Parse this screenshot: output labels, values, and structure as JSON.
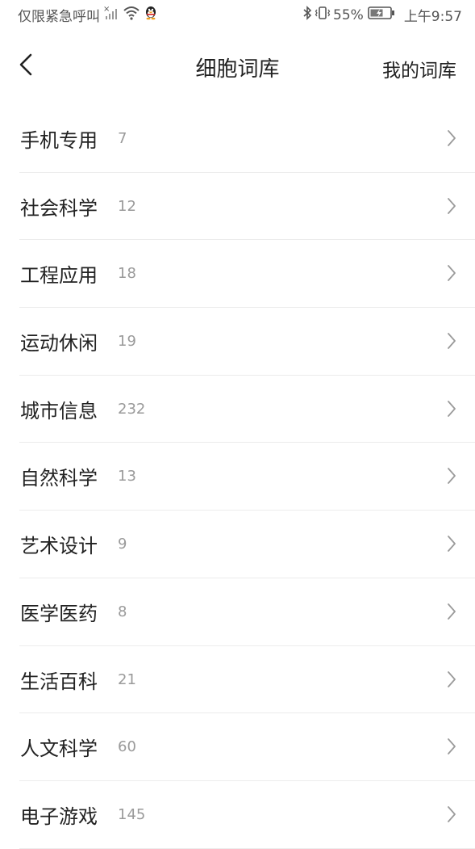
{
  "status_bar": {
    "carrier": "仅限紧急呼叫",
    "battery_percent": "55%",
    "time": "上午9:57"
  },
  "nav": {
    "title": "细胞词库",
    "right_link": "我的词库"
  },
  "categories": [
    {
      "label": "手机专用",
      "count": "7"
    },
    {
      "label": "社会科学",
      "count": "12"
    },
    {
      "label": "工程应用",
      "count": "18"
    },
    {
      "label": "运动休闲",
      "count": "19"
    },
    {
      "label": "城市信息",
      "count": "232"
    },
    {
      "label": "自然科学",
      "count": "13"
    },
    {
      "label": "艺术设计",
      "count": "9"
    },
    {
      "label": "医学医药",
      "count": "8"
    },
    {
      "label": "生活百科",
      "count": "21"
    },
    {
      "label": "人文科学",
      "count": "60"
    },
    {
      "label": "电子游戏",
      "count": "145"
    }
  ],
  "icons": {
    "back": "chevron-left-icon",
    "row_arrow": "chevron-right-icon"
  },
  "colors": {
    "text": "#222222",
    "count": "#9a9a9a",
    "divider": "#ececec",
    "chevron": "#9a9a9a"
  }
}
